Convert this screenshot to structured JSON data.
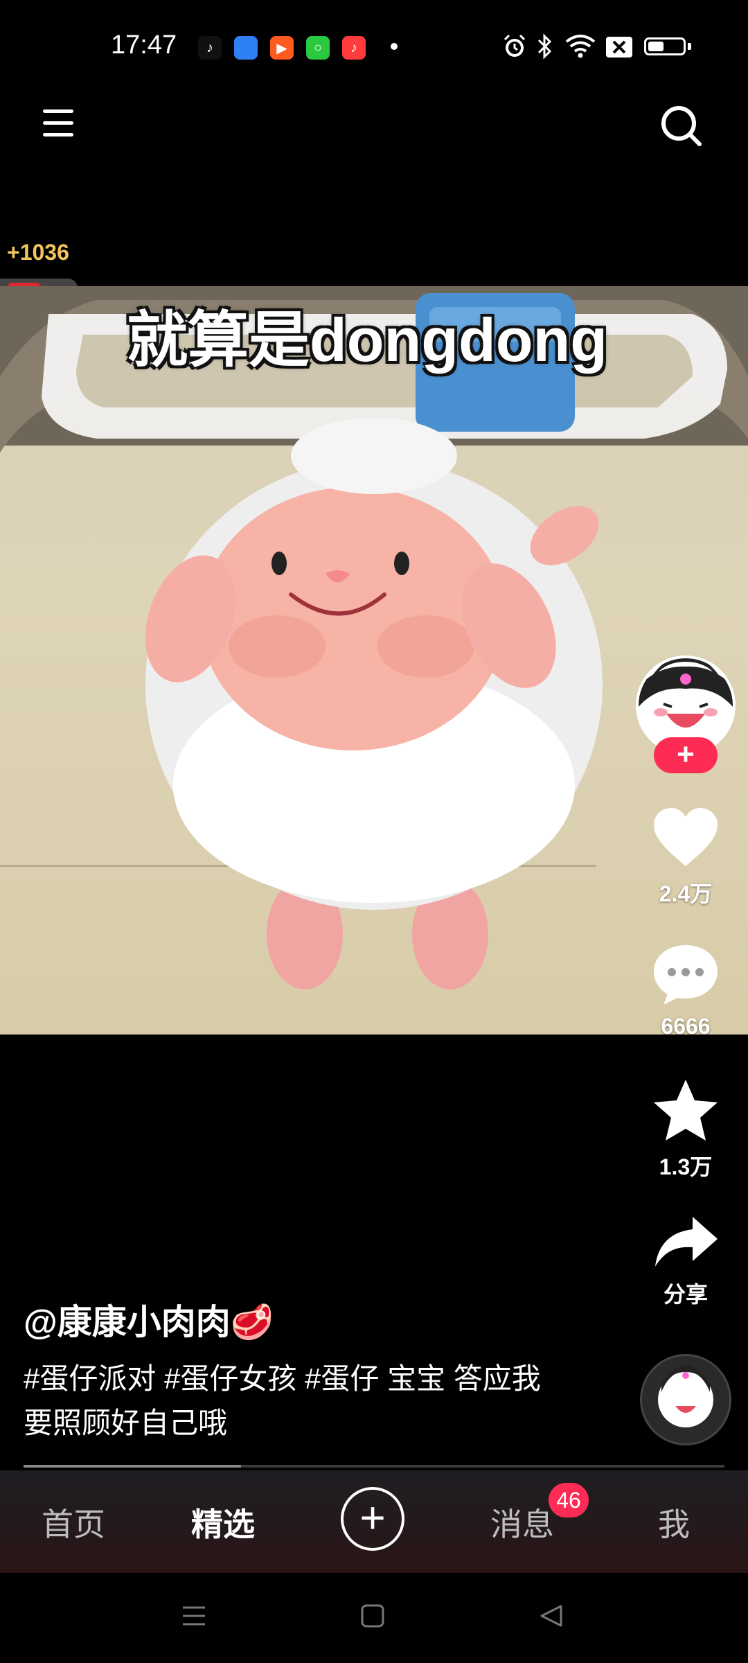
{
  "status_bar": {
    "time": "17:47",
    "notification_apps": [
      "tiktok-icon",
      "blue-app-icon",
      "video-app-icon",
      "green-app-icon",
      "music-app-icon"
    ],
    "system_icons": [
      "alarm-icon",
      "bluetooth-icon",
      "wifi-icon",
      "sim-off-icon",
      "battery-icon"
    ]
  },
  "top_nav": {
    "menu_icon": "menu-icon",
    "search_icon": "search-icon"
  },
  "coin_reward": {
    "amount": "+1036"
  },
  "video": {
    "subtitle": "就算是dongdong"
  },
  "actions": {
    "like_count": "2.4万",
    "comment_count": "6666",
    "favorite_count": "1.3万",
    "share_label": "分享"
  },
  "caption": {
    "author": "@康康小肉肉🥩",
    "description": "#蛋仔派对 #蛋仔女孩 #蛋仔 宝宝 答应我要照顾好自己哦"
  },
  "playback": {
    "progress": 0.31
  },
  "bottom_nav": {
    "home": "首页",
    "featured": "精选",
    "create_icon": "plus-icon",
    "messages": "消息",
    "messages_badge": "46",
    "me": "我"
  },
  "colors": {
    "accent": "#fe2c55",
    "coin": "#f3c55a"
  }
}
